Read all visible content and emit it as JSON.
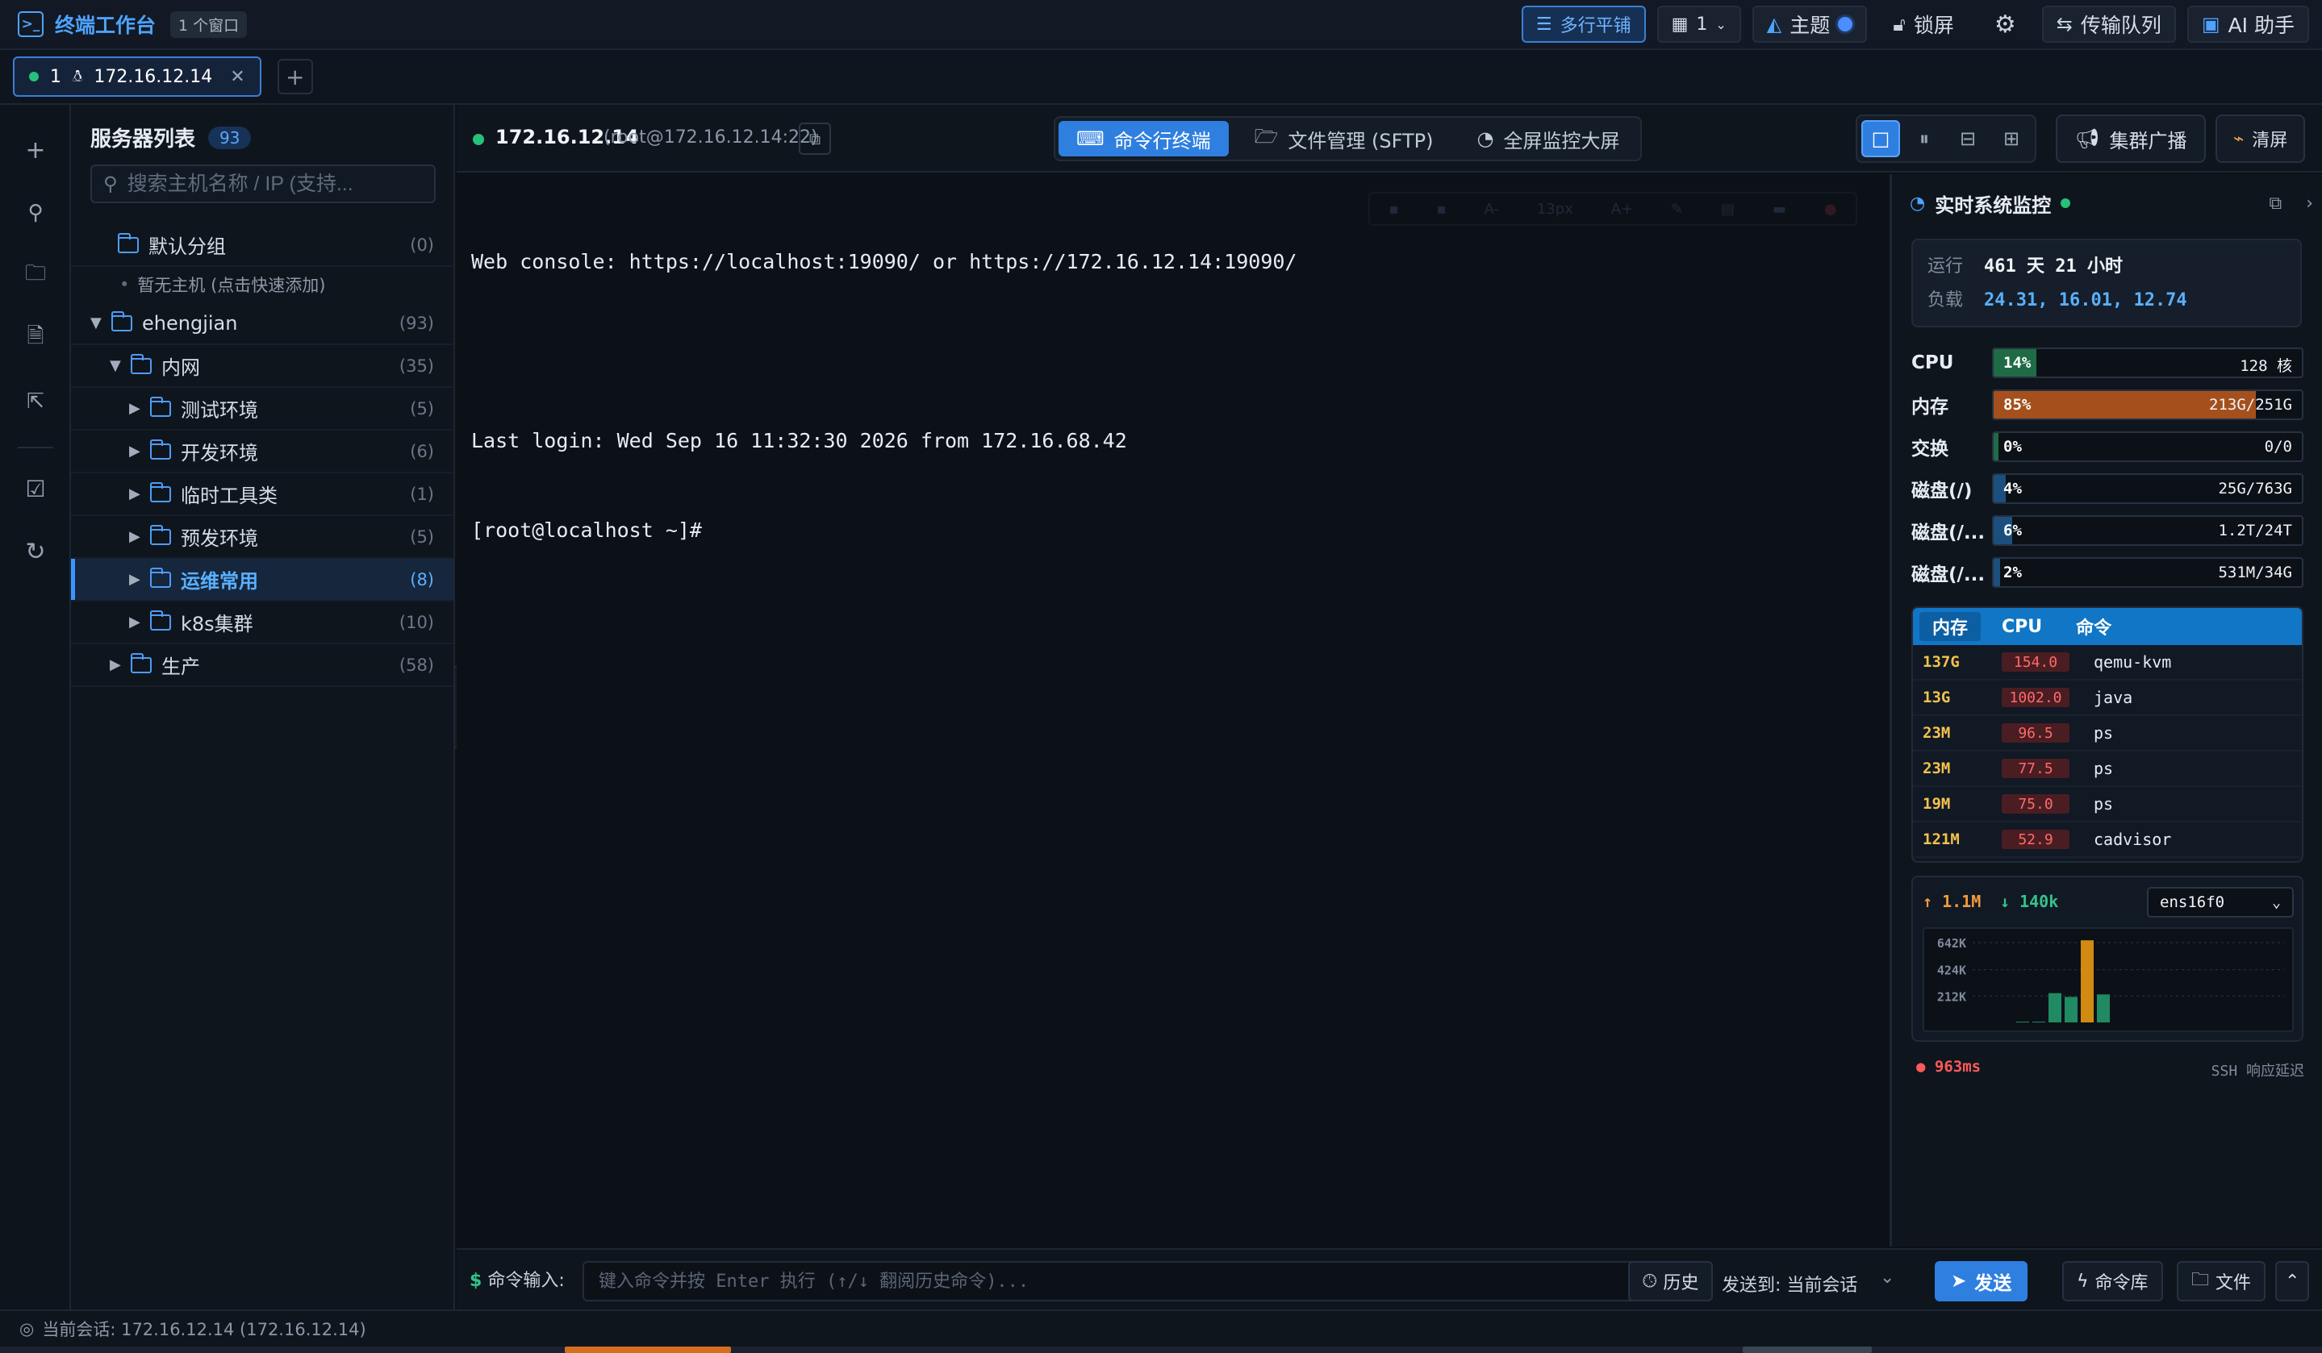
{
  "topbar": {
    "logo_glyph": ">_",
    "title": "终端工作台",
    "window_badge": "1 个窗口",
    "tile_label": "多行平铺",
    "layout_count": "1",
    "theme_label": "主题",
    "lock_label": "锁屏",
    "transfer_label": "传输队列",
    "ai_label": "AI 助手"
  },
  "tabs": [
    {
      "index": "1",
      "title": "172.16.12.14",
      "status_color": "#26c17a"
    }
  ],
  "sidebar": {
    "title": "服务器列表",
    "count": "93",
    "search_placeholder": "搜索主机名称 / IP (支持...",
    "tree": [
      {
        "label": "默认分组",
        "count": "(0)"
      },
      {
        "label": "暂无主机 (点击快速添加)"
      },
      {
        "label": "ehengjian",
        "count": "(93)"
      },
      {
        "label": "内网",
        "count": "(35)"
      },
      {
        "label": "测试环境",
        "count": "(5)"
      },
      {
        "label": "开发环境",
        "count": "(6)"
      },
      {
        "label": "临时工具类",
        "count": "(1)"
      },
      {
        "label": "预发环境",
        "count": "(5)"
      },
      {
        "label": "运维常用",
        "count": "(8)"
      },
      {
        "label": "k8s集群",
        "count": "(10)"
      },
      {
        "label": "生产",
        "count": "(58)"
      }
    ]
  },
  "session": {
    "ip": "172.16.12.14",
    "user": "(root@172.16.12.14:22)",
    "modes": [
      "命令行终端",
      "文件管理 (SFTP)",
      "全屏监控大屏"
    ],
    "broadcast_label": "集群广播",
    "clear_label": "清屏"
  },
  "terminal": {
    "lines": [
      "Web console: https://localhost:19090/ or https://172.16.12.14:19090/",
      "",
      "Last login: Wed Sep 16 11:32:30 2026 from 172.16.68.42",
      "[root@localhost ~]#"
    ],
    "tools": [
      "A-",
      "13px",
      "A+"
    ]
  },
  "monitor": {
    "title": "实时系统监控",
    "uptime_label": "运行",
    "uptime_value": "461 天 21 小时",
    "load_label": "负载",
    "load_value": "24.31, 16.01, 12.74",
    "metrics": [
      {
        "label": "CPU",
        "pct": 14,
        "pct_text": "14%",
        "cap": "128 核",
        "color": "#1f6b46"
      },
      {
        "label": "内存",
        "pct": 85,
        "pct_text": "85%",
        "cap": "213G/251G",
        "color": "#a5501c"
      },
      {
        "label": "交换",
        "pct": 0,
        "pct_text": "0%",
        "cap": "0/0",
        "color": "#1f6b46"
      },
      {
        "label": "磁盘(/)",
        "pct": 4,
        "pct_text": "4%",
        "cap": "25G/763G",
        "color": "#1c4f7d"
      },
      {
        "label": "磁盘(/...",
        "pct": 6,
        "pct_text": "6%",
        "cap": "1.2T/24T",
        "color": "#1c4f7d"
      },
      {
        "label": "磁盘(/...",
        "pct": 2,
        "pct_text": "2%",
        "cap": "531M/34G",
        "color": "#1c4f7d"
      }
    ],
    "proc_tabs": [
      "内存",
      "CPU",
      "命令"
    ],
    "processes": [
      {
        "mem": "137G",
        "cpu": "154.0",
        "name": "qemu-kvm"
      },
      {
        "mem": "13G",
        "cpu": "1002.0",
        "name": "java"
      },
      {
        "mem": "23M",
        "cpu": "96.5",
        "name": "ps"
      },
      {
        "mem": "23M",
        "cpu": "77.5",
        "name": "ps"
      },
      {
        "mem": "19M",
        "cpu": "75.0",
        "name": "ps"
      },
      {
        "mem": "121M",
        "cpu": "52.9",
        "name": "cadvisor"
      }
    ],
    "net": {
      "up": "↑ 1.1M",
      "down": "↓ 140k",
      "iface": "ens16f0"
    },
    "latency": "● 963ms",
    "latency_note": "SSH 响应延迟"
  },
  "chart_data": {
    "type": "bar",
    "title": "",
    "xlabel": "",
    "ylabel": "",
    "yticks": [
      "642K",
      "424K",
      "212K"
    ],
    "ylim": [
      0,
      700
    ],
    "series": [
      {
        "values": [
          0,
          0,
          0,
          0,
          0,
          0,
          0,
          0,
          0,
          0,
          0,
          0,
          0,
          0,
          0,
          0,
          0,
          0,
          0,
          0,
          0,
          0,
          0,
          0,
          0,
          0,
          0,
          0,
          0,
          0,
          0,
          0,
          0,
          0,
          0,
          0,
          0,
          0,
          0,
          0,
          0,
          0,
          0,
          0,
          0,
          0,
          0,
          0,
          0,
          0,
          0,
          0,
          0,
          0,
          0,
          0,
          0,
          0,
          0,
          0
        ]
      },
      {
        "values": [
          0,
          0,
          0,
          0,
          0,
          0,
          0,
          0,
          0,
          0,
          0,
          0,
          0,
          0,
          0,
          0,
          0,
          0,
          0,
          0,
          0,
          0,
          0,
          0,
          0,
          0,
          0,
          0,
          0,
          0,
          0,
          0,
          0,
          0,
          0,
          0,
          0,
          0,
          0,
          0,
          0,
          0,
          0,
          0,
          0,
          0,
          0,
          0,
          0,
          0,
          0,
          0,
          0,
          0,
          0,
          0,
          0,
          0,
          0,
          0
        ]
      }
    ],
    "bars": [
      {
        "x": 0,
        "value": 6,
        "color": "#1f8a64"
      },
      {
        "x": 1,
        "value": 6,
        "color": "#1f8a64"
      },
      {
        "x": 2,
        "value": 235,
        "color": "#1f8a64"
      },
      {
        "x": 3,
        "value": 205,
        "color": "#1f8a64"
      },
      {
        "x": 4,
        "value": 660,
        "color": "#d18a12"
      },
      {
        "x": 5,
        "value": 225,
        "color": "#1f8a64"
      }
    ]
  },
  "cmd": {
    "label": "命令输入:",
    "placeholder": "键入命令并按 Enter 执行 (↑/↓ 翻阅历史命令)...",
    "history_label": "历史",
    "send_to": "发送到: 当前会话",
    "send_label": "发送",
    "library_label": "命令库",
    "file_label": "文件"
  },
  "status": {
    "session_text": "当前会话: 172.16.12.14 (172.16.12.14)"
  }
}
